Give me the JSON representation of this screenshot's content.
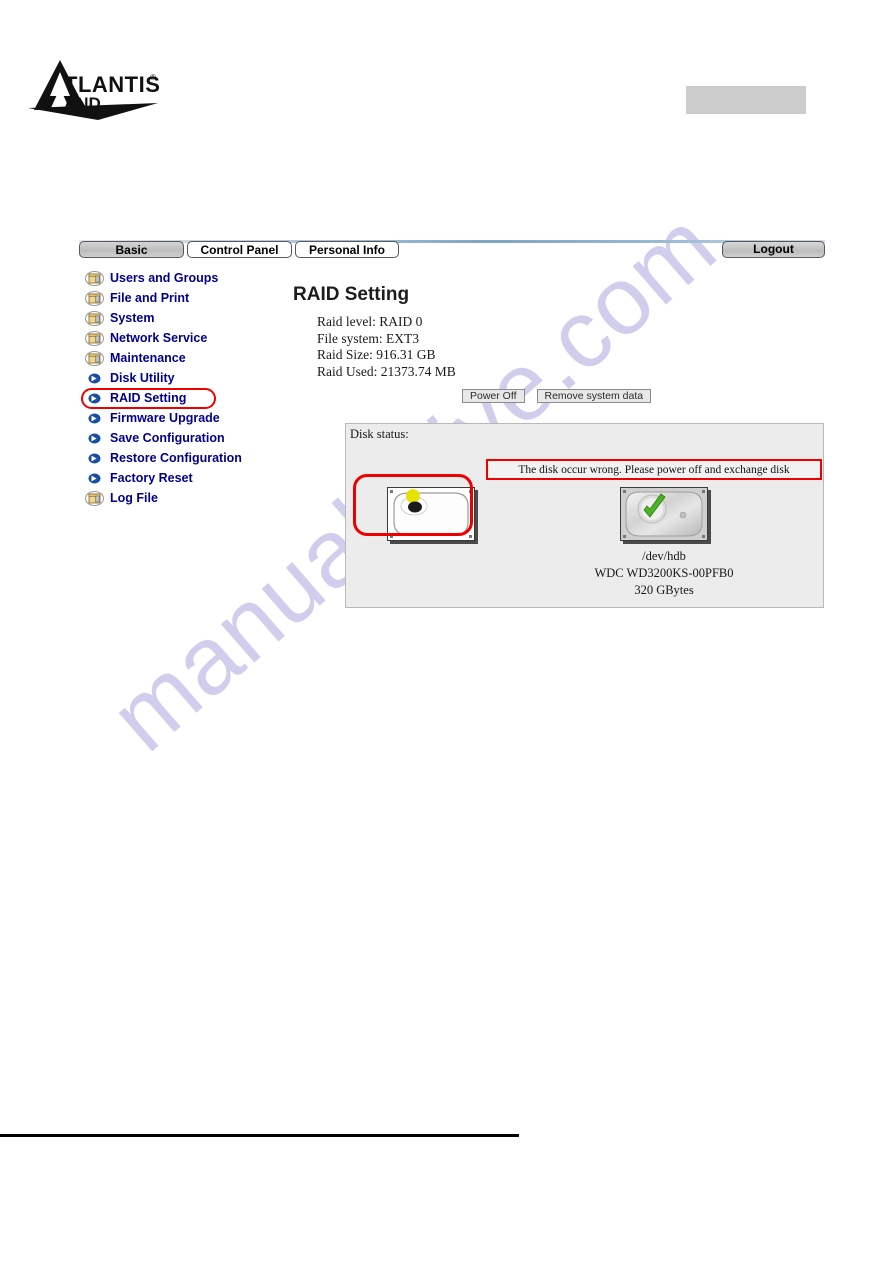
{
  "header": {
    "logo_text_main": "ATLANTIS",
    "logo_text_sub": "LAND",
    "logo_registered": "®"
  },
  "tabs": [
    {
      "label": "Basic",
      "selected": true
    },
    {
      "label": "Control Panel",
      "selected": false
    },
    {
      "label": "Personal Info",
      "selected": false
    }
  ],
  "logout": {
    "label": "Logout"
  },
  "sidebar": {
    "items": [
      {
        "label": "Users and Groups",
        "icon": "folder-icon",
        "selected": false
      },
      {
        "label": "File and Print",
        "icon": "folder-icon",
        "selected": false
      },
      {
        "label": "System",
        "icon": "folder-icon",
        "selected": false
      },
      {
        "label": "Network Service",
        "icon": "folder-icon",
        "selected": false
      },
      {
        "label": "Maintenance",
        "icon": "folder-icon",
        "selected": false
      },
      {
        "label": "Disk Utility",
        "icon": "blue-arrow-icon",
        "selected": false
      },
      {
        "label": "RAID Setting",
        "icon": "blue-arrow-icon",
        "selected": true
      },
      {
        "label": "Firmware Upgrade",
        "icon": "blue-arrow-icon",
        "selected": false
      },
      {
        "label": "Save Configuration",
        "icon": "blue-arrow-icon",
        "selected": false
      },
      {
        "label": "Restore Configuration",
        "icon": "blue-arrow-icon",
        "selected": false
      },
      {
        "label": "Factory Reset",
        "icon": "blue-arrow-icon",
        "selected": false
      },
      {
        "label": "Log File",
        "icon": "folder-icon",
        "selected": false
      }
    ]
  },
  "content": {
    "title": "RAID Setting",
    "info": [
      {
        "key": "Raid level:",
        "value": "RAID 0"
      },
      {
        "key": "File system:",
        "value": "EXT3"
      },
      {
        "key": "Raid Size:",
        "value": "916.31 GB"
      },
      {
        "key": "Raid Used:",
        "value": "21373.74 MB"
      }
    ],
    "buttons": [
      {
        "label": "Power Off"
      },
      {
        "label": "Remove system data"
      }
    ],
    "disk_status": {
      "label": "Disk status:",
      "warning": "The disk occur wrong. Please power off and exchange disk",
      "disks": [
        {
          "icon": "broken-image-icon",
          "state": "error",
          "device": "",
          "model": "",
          "capacity": ""
        },
        {
          "icon": "hard-disk-ok-icon",
          "state": "ok",
          "device": "/dev/hdb",
          "model": "WDC WD3200KS-00PFB0",
          "capacity": "320 GBytes"
        }
      ]
    }
  },
  "watermark": {
    "text": "manualshive.com"
  },
  "colors": {
    "nav_text": "#00008B",
    "alert_red": "#EE0000",
    "panel_bg": "#ECECEC",
    "tab_selected": "#C6C6C6"
  }
}
